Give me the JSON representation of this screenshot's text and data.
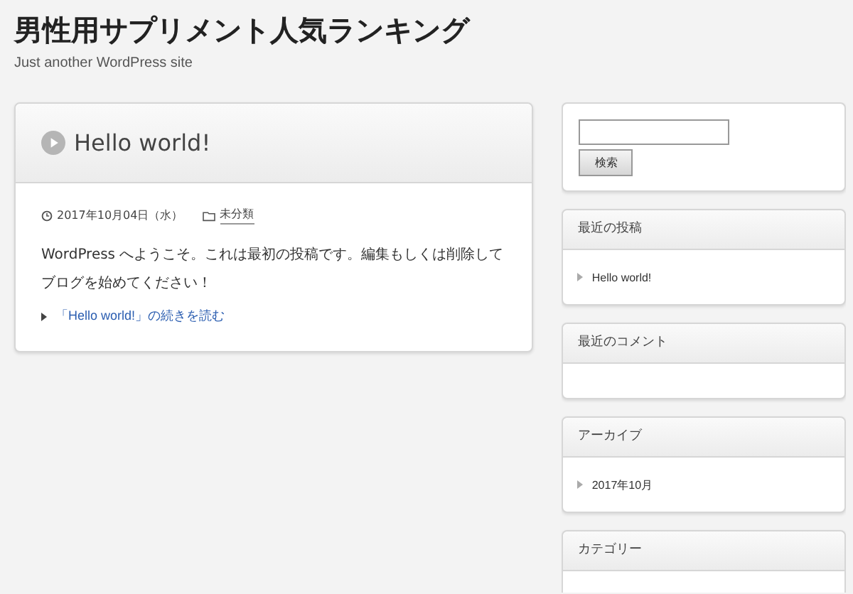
{
  "site": {
    "title": "男性用サプリメント人気ランキング",
    "tagline": "Just another WordPress site"
  },
  "post": {
    "title": "Hello world!",
    "date": "2017年10月04日（水）",
    "category": "未分類",
    "body": "WordPress へようこそ。これは最初の投稿です。編集もしくは削除してブログを始めてください！",
    "more_link": "「Hello world!」の続きを読む"
  },
  "search": {
    "button": "検索"
  },
  "widgets": [
    {
      "title": "最近の投稿",
      "items": [
        "Hello world!"
      ]
    },
    {
      "title": "最近のコメント"
    },
    {
      "title": "アーカイブ",
      "items": [
        "2017年10月"
      ]
    },
    {
      "title": "カテゴリー"
    }
  ]
}
